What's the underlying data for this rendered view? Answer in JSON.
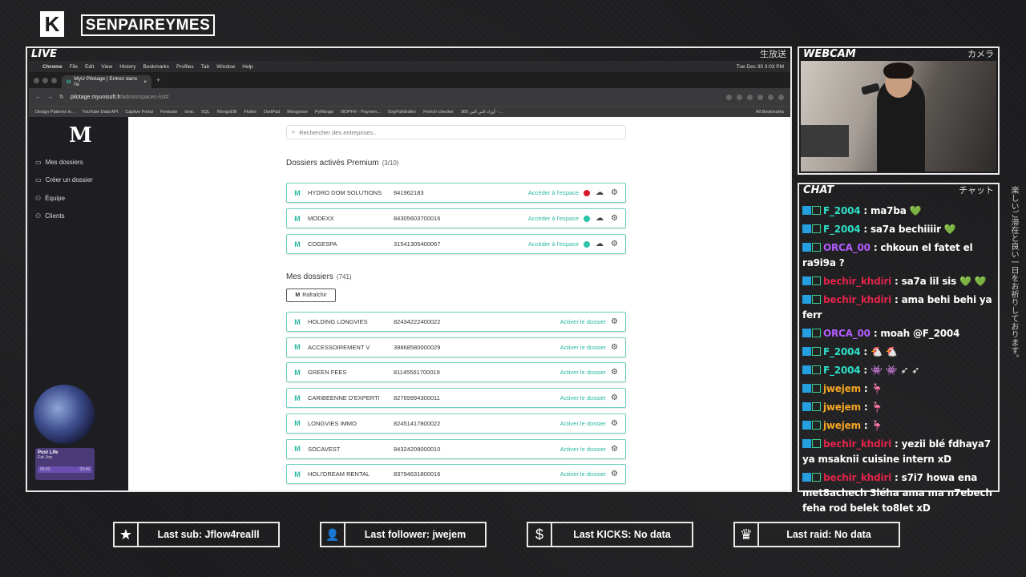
{
  "channel": {
    "name": "SENPAIREYMES"
  },
  "panels": {
    "live": {
      "title": "LIVE",
      "jp": "生放送"
    },
    "webcam": {
      "title": "WEBCAM",
      "jp": "カメラ"
    },
    "chat": {
      "title": "CHAT",
      "jp": "チャット"
    },
    "side_jp": "楽しいご滞在と良い一日をお祈りしております。"
  },
  "browser": {
    "menubar": [
      "Chrome",
      "File",
      "Edit",
      "View",
      "History",
      "Bookmarks",
      "Profiles",
      "Tab",
      "Window",
      "Help"
    ],
    "clock": "Tue Dec 30  3:03 PM",
    "tab_title": "MyU Pilotage | Entrez dans l'e",
    "url_host": "pilotage.myunisoft.fr",
    "url_path": "/admin/spaces-list#",
    "bookmarks": [
      "Design Patterns in...",
      "YouTube Data API",
      "Captive Portal",
      "Firebase",
      "Ionic",
      "SQL",
      "MongoDB",
      "Flutter",
      "DartPad",
      "Mongoose",
      "PyMongo",
      "MOPHY - Paymen...",
      "SvgPathEditor",
      "French checker",
      "360 أوراد التي الين - ...",
      "All Bookmarks"
    ]
  },
  "app": {
    "sidebar": {
      "logo": "M",
      "items": [
        "Mes dossiers",
        "Créer un dossier",
        "Équipe",
        "Clients"
      ],
      "player_title": "Post Life",
      "player_sub": "Fat Joe",
      "player_time_left": "00:33",
      "player_time_right": "03:49"
    },
    "search_placeholder": "Rechercher des entreprises..",
    "premium": {
      "title": "Dossiers activés Premium",
      "count": "(3/10)",
      "rows": [
        {
          "name": "HYDRO DOM SOLUTIONS",
          "number": "841962183",
          "action": "Accéder à l'espace",
          "status_color": "#d81b2c"
        },
        {
          "name": "MODEXX",
          "number": "84305603700016",
          "action": "Accéder à l'espace",
          "status_color": "#2bc4a8"
        },
        {
          "name": "COGESPA",
          "number": "31541305400067",
          "action": "Accéder à l'espace",
          "status_color": "#2bc4a8"
        }
      ]
    },
    "mine": {
      "title": "Mes dossiers",
      "count": "(741)",
      "refresh_label": "Rafraîchir",
      "rows": [
        {
          "name": "HOLDING LONGVIES",
          "number": "82434222400022",
          "action": "Activer le dossier"
        },
        {
          "name": "ACCESSOIREMENT V",
          "number": "39868580000029",
          "action": "Activer le dossier"
        },
        {
          "name": "GREEN FEES",
          "number": "81145561700019",
          "action": "Activer le dossier"
        },
        {
          "name": "CARIBEENNE D'EXPERTI",
          "number": "82769994300011",
          "action": "Activer le dossier"
        },
        {
          "name": "LONGVIES IMMO",
          "number": "82451417800022",
          "action": "Activer le dossier"
        },
        {
          "name": "SOCAVEST",
          "number": "84324209000010",
          "action": "Activer le dossier"
        },
        {
          "name": "HOLI'DREAM RENTAL",
          "number": "83794631800016",
          "action": "Activer le dossier"
        }
      ]
    }
  },
  "chat": [
    {
      "user": "F_2004",
      "color": "teal",
      "text": "ma7ba 💚"
    },
    {
      "user": "F_2004",
      "color": "teal",
      "text": "sa7a bechiiiir 💚"
    },
    {
      "user": "ORCA_00",
      "color": "purple",
      "text": "chkoun el fatet el ra9i9a ?"
    },
    {
      "user": "bechir_khdiri",
      "color": "red",
      "text": "sa7a lil sis 💚 💚"
    },
    {
      "user": "bechir_khdiri",
      "color": "red",
      "text": "ama behi behi ya ferr"
    },
    {
      "user": "ORCA_00",
      "color": "purple",
      "text": "moah @F_2004"
    },
    {
      "user": "F_2004",
      "color": "teal",
      "text": "🐔 🐔"
    },
    {
      "user": "F_2004",
      "color": "teal",
      "text": "👾 👾 ➶ ➶"
    },
    {
      "user": "jwejem",
      "color": "orange",
      "text": "🦩"
    },
    {
      "user": "jwejem",
      "color": "orange",
      "text": "🦩"
    },
    {
      "user": "jwejem",
      "color": "orange",
      "text": "🦩"
    },
    {
      "user": "bechir_khdiri",
      "color": "red",
      "text": "yezii blé fdhaya7 ya msaknii cuisine intern xD"
    },
    {
      "user": "bechir_khdiri",
      "color": "red",
      "text": "s7i7 howa ena met8achech 3léha ama ma n7ebech feha rod belek to8let xD"
    }
  ],
  "stats": [
    {
      "icon": "star-icon",
      "glyph": "★",
      "label": "Last sub: Jflow4realll"
    },
    {
      "icon": "user-plus-icon",
      "glyph": "👤",
      "label": "Last follower: jwejem"
    },
    {
      "icon": "dollar-icon",
      "glyph": "$",
      "label": "Last KICKS: No data"
    },
    {
      "icon": "crown-icon",
      "glyph": "♛",
      "label": "Last raid: No data"
    }
  ]
}
